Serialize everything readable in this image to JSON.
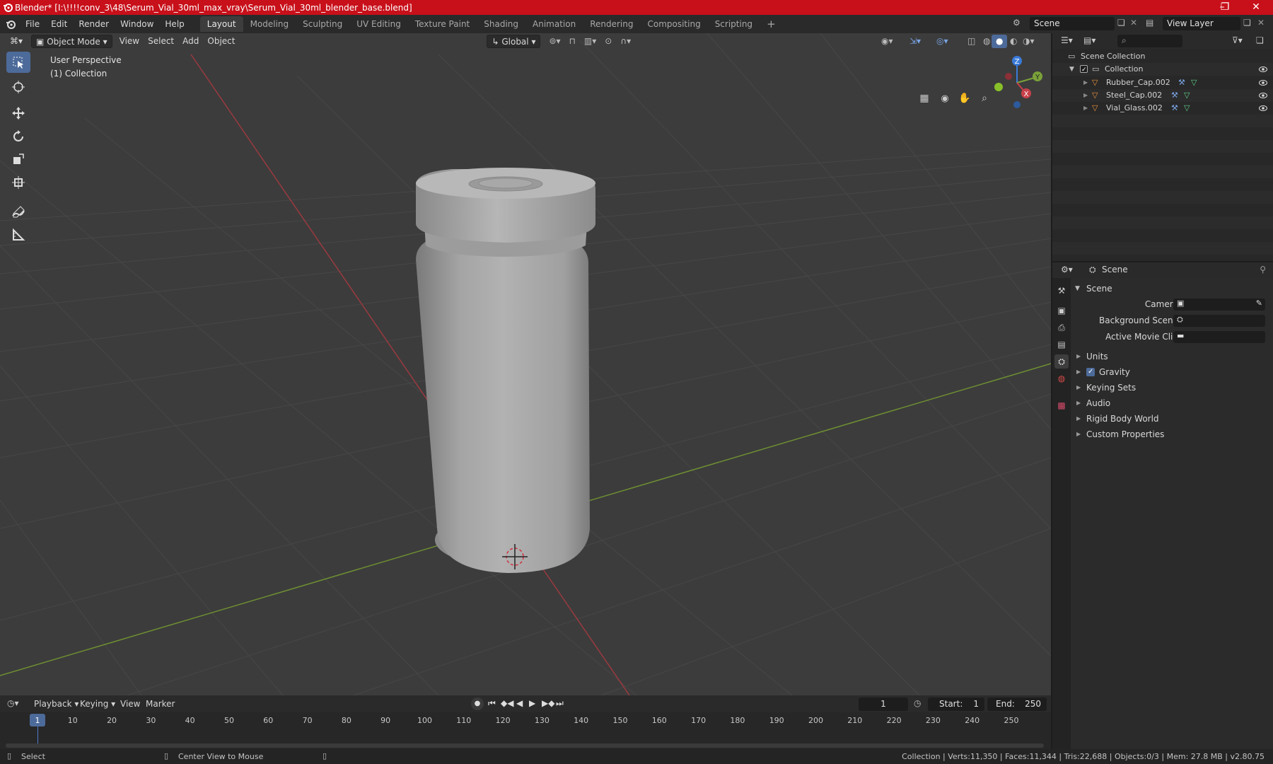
{
  "window": {
    "title": "Blender* [I:\\!!!!conv_3\\48\\Serum_Vial_30ml_max_vray\\Serum_Vial_30ml_blender_base.blend]",
    "controls": [
      "–",
      "❐",
      "✕"
    ]
  },
  "menu": [
    "File",
    "Edit",
    "Render",
    "Window",
    "Help"
  ],
  "workspaces": [
    "Layout",
    "Modeling",
    "Sculpting",
    "UV Editing",
    "Texture Paint",
    "Shading",
    "Animation",
    "Rendering",
    "Compositing",
    "Scripting"
  ],
  "workspace_add": "+",
  "scene_field": "Scene",
  "view_layer_field": "View Layer",
  "viewport": {
    "mode": "Object Mode",
    "menus": [
      "View",
      "Select",
      "Add",
      "Object"
    ],
    "orientation": "Global",
    "perspective_label": "User Perspective",
    "collection_label": "(1) Collection",
    "gizmo_axes": {
      "z": "Z",
      "y": "Y",
      "x": "X"
    }
  },
  "outliner": {
    "root": "Scene Collection",
    "collection": "Collection",
    "objects": [
      "Rubber_Cap.002",
      "Steel_Cap.002",
      "Vial_Glass.002"
    ]
  },
  "properties": {
    "header": "Scene",
    "panel": "Scene",
    "fields": [
      {
        "label": "Camera",
        "value": ""
      },
      {
        "label": "Background Scene",
        "value": ""
      },
      {
        "label": "Active Movie Clip",
        "value": ""
      }
    ],
    "subpanels": [
      "Units",
      "Gravity",
      "Keying Sets",
      "Audio",
      "Rigid Body World",
      "Custom Properties"
    ],
    "gravity_checked": true
  },
  "timeline": {
    "menus": [
      "Playback",
      "Keying",
      "View",
      "Marker"
    ],
    "current_frame": "1",
    "start_label": "Start:",
    "start": "1",
    "end_label": "End:",
    "end": "250",
    "ticks": [
      "1",
      "10",
      "20",
      "30",
      "40",
      "50",
      "60",
      "70",
      "80",
      "90",
      "100",
      "110",
      "120",
      "130",
      "140",
      "150",
      "160",
      "170",
      "180",
      "190",
      "200",
      "210",
      "220",
      "230",
      "240",
      "250"
    ]
  },
  "status": {
    "select": "Select",
    "center_view": "Center View to Mouse",
    "stats": "Collection | Verts:11,350 | Faces:11,344 | Tris:22,688 | Objects:0/3 | Mem: 27.8 MB | v2.80.75"
  },
  "colors": {
    "title_bar": "#c8101a",
    "accent": "#4d6b9a",
    "object_icon": "#e8923a",
    "x_axis": "#c8404a",
    "y_axis": "#7ba23a",
    "z_axis": "#3a7ad8"
  }
}
